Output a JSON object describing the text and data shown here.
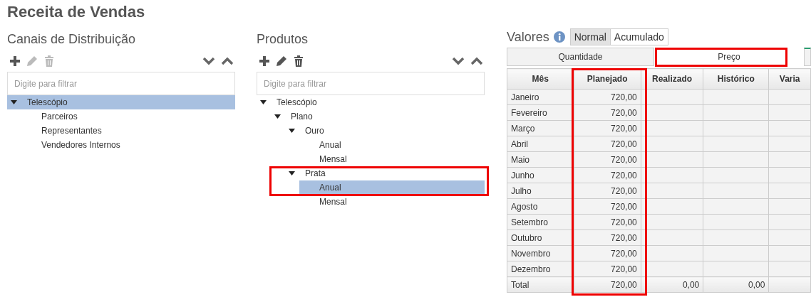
{
  "page_title": "Receita de Vendas",
  "channels": {
    "heading": "Canais de Distribuição",
    "filter": {
      "placeholder": "Digite para filtrar"
    },
    "toolbar": {
      "add_disabled": false,
      "edit_disabled": true,
      "delete_disabled": true
    },
    "tree": [
      {
        "label": "Telescópio",
        "expanded": true,
        "selected": true,
        "children": [
          {
            "label": "Parceiros",
            "selected": false
          },
          {
            "label": "Representantes",
            "selected": false
          },
          {
            "label": "Vendedores Internos",
            "selected": false
          }
        ]
      }
    ]
  },
  "products": {
    "heading": "Produtos",
    "filter": {
      "placeholder": "Digite para filtrar"
    },
    "toolbar": {
      "add_disabled": false,
      "edit_disabled": false,
      "delete_disabled": false
    },
    "tree": [
      {
        "label": "Telescópio",
        "expanded": true,
        "selected": false,
        "children": [
          {
            "label": "Plano",
            "expanded": true,
            "selected": false,
            "children": [
              {
                "label": "Ouro",
                "expanded": true,
                "selected": false,
                "children": [
                  {
                    "label": "Anual",
                    "selected": false
                  },
                  {
                    "label": "Mensal",
                    "selected": false
                  }
                ]
              },
              {
                "label": "Prata",
                "expanded": true,
                "selected": false,
                "highlighted": true,
                "children": [
                  {
                    "label": "Anual",
                    "selected": true
                  },
                  {
                    "label": "Mensal",
                    "selected": false
                  }
                ]
              }
            ]
          }
        ]
      }
    ]
  },
  "values": {
    "heading": "Valores",
    "modes": [
      {
        "label": "Normal",
        "selected": true
      },
      {
        "label": "Acumulado",
        "selected": false
      }
    ],
    "tabs": [
      {
        "label": "Quantidade",
        "selected": false,
        "highlighted": false
      },
      {
        "label": "Preço",
        "selected": true,
        "highlighted": true
      },
      {
        "selected": false,
        "highlighted": false
      }
    ],
    "table": {
      "columns": [
        {
          "label": "Mês",
          "highlighted": false
        },
        {
          "label": "Planejado",
          "highlighted": true
        },
        {
          "label": "Realizado",
          "highlighted": false
        },
        {
          "label": "Histórico",
          "highlighted": false
        },
        {
          "label": "Varia",
          "highlighted": false
        }
      ],
      "rows": [
        {
          "kind": "month",
          "cells": [
            "Janeiro",
            "720,00"
          ]
        },
        {
          "kind": "month",
          "cells": [
            "Fevereiro",
            "720,00"
          ]
        },
        {
          "kind": "month",
          "cells": [
            "Março",
            "720,00"
          ]
        },
        {
          "kind": "month",
          "cells": [
            "Abril",
            "720,00"
          ]
        },
        {
          "kind": "month",
          "cells": [
            "Maio",
            "720,00"
          ]
        },
        {
          "kind": "month",
          "cells": [
            "Junho",
            "720,00"
          ]
        },
        {
          "kind": "month",
          "cells": [
            "Julho",
            "720,00"
          ]
        },
        {
          "kind": "month",
          "cells": [
            "Agosto",
            "720,00"
          ]
        },
        {
          "kind": "month",
          "cells": [
            "Setembro",
            "720,00"
          ]
        },
        {
          "kind": "month",
          "cells": [
            "Outubro",
            "720,00"
          ]
        },
        {
          "kind": "month",
          "cells": [
            "Novembro",
            "720,00"
          ]
        },
        {
          "kind": "month",
          "cells": [
            "Dezembro",
            "720,00"
          ]
        },
        {
          "kind": "total",
          "cells": [
            "Total",
            "720,00",
            "0,00",
            "0,00"
          ]
        }
      ]
    }
  }
}
